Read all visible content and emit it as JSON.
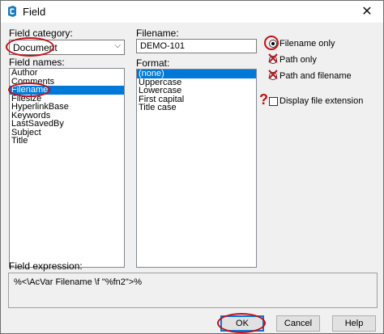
{
  "window": {
    "title": "Field",
    "close_glyph": "✕"
  },
  "left": {
    "category_label": "Field category:",
    "category_value": "Document",
    "names_label": "Field names:",
    "names": [
      "Author",
      "Comments",
      "Filename",
      "Filesize",
      "HyperlinkBase",
      "Keywords",
      "LastSavedBy",
      "Subject",
      "Title"
    ],
    "selected_index": 2
  },
  "middle": {
    "filename_label": "Filename:",
    "filename_value": "DEMO-101",
    "format_label": "Format:",
    "formats": [
      "(none)",
      "Uppercase",
      "Lowercase",
      "First capital",
      "Title case"
    ],
    "selected_index": 0
  },
  "options": {
    "filename_only": "Filename only",
    "path_only": "Path only",
    "path_and_filename": "Path and filename",
    "display_extension": "Display file extension",
    "question_glyph": "?"
  },
  "expression": {
    "label": "Field expression:",
    "value": "%<\\AcVar Filename \\f \"%fn2\">%"
  },
  "buttons": {
    "ok": "OK",
    "cancel": "Cancel",
    "help": "Help"
  },
  "colors": {
    "selection": "#0078d7",
    "annotation": "#c0101a"
  }
}
